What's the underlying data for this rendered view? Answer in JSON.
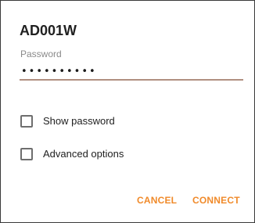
{
  "dialog": {
    "title": "AD001W",
    "password_label": "Password",
    "password_value": "••••••••••",
    "show_password": {
      "label": "Show password",
      "checked": false
    },
    "advanced_options": {
      "label": "Advanced options",
      "checked": false
    },
    "cancel_label": "CANCEL",
    "connect_label": "CONNECT"
  },
  "colors": {
    "accent": "#f08a2a",
    "underline": "#b08f80",
    "text": "#212121",
    "label": "#8a8a8a"
  }
}
